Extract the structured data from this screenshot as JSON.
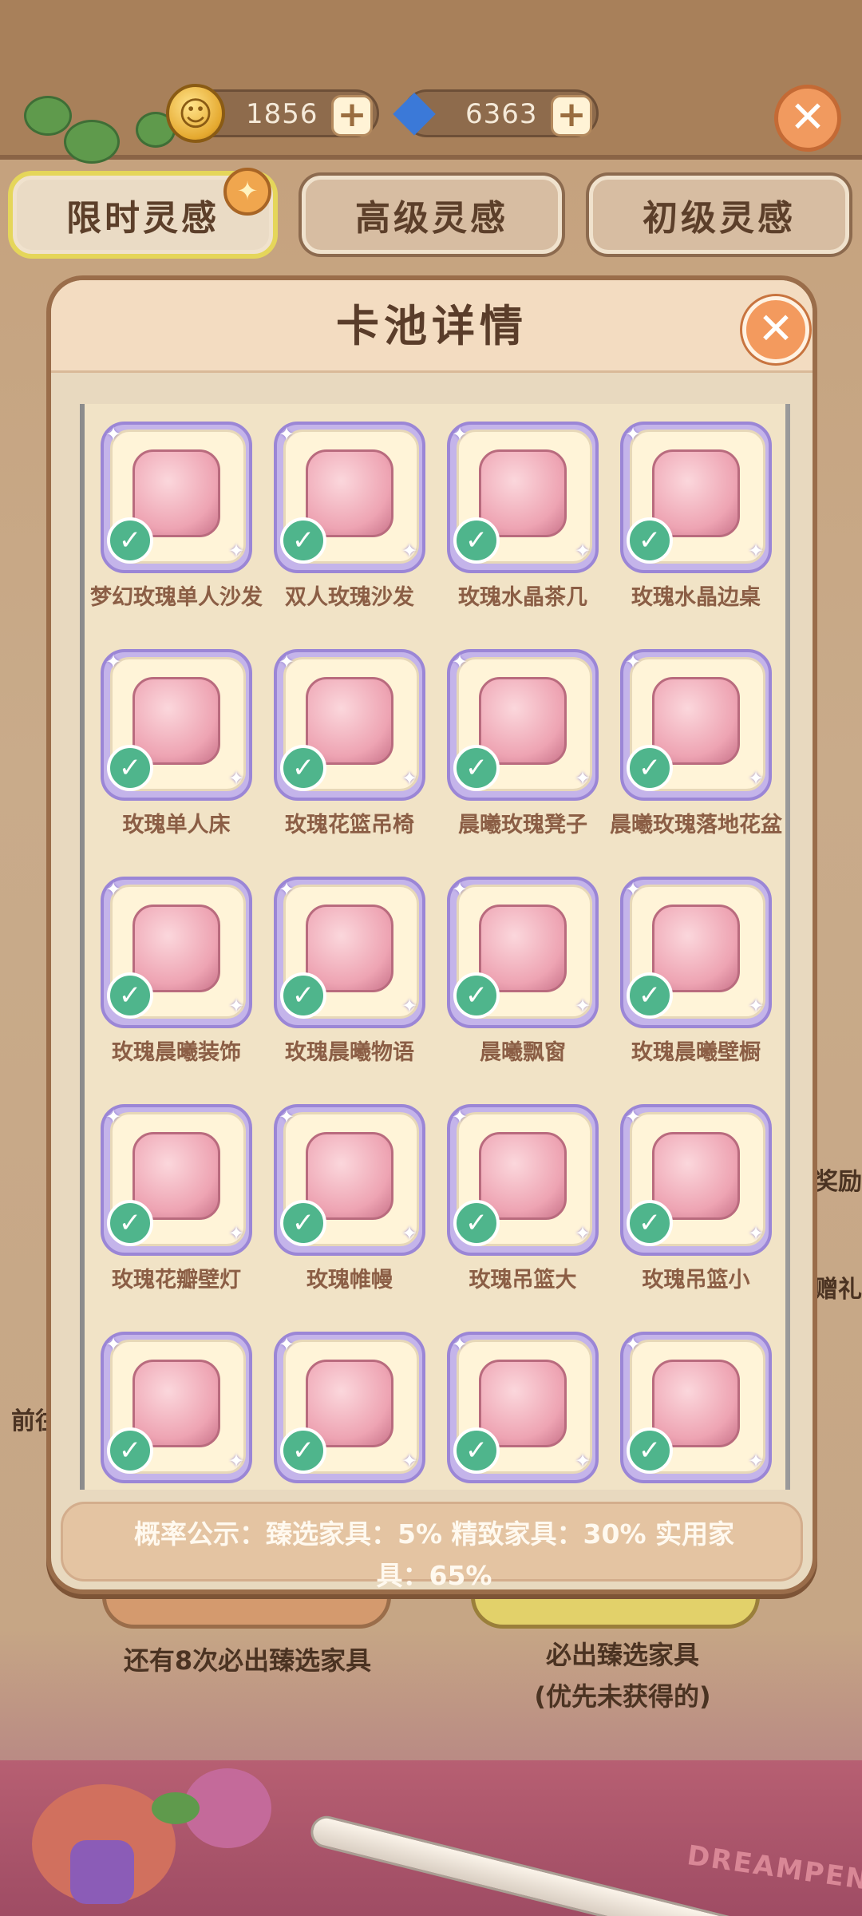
{
  "currency": {
    "coins": "1856",
    "gems": "6363"
  },
  "tabs": [
    {
      "label": "限时灵感",
      "active": true
    },
    {
      "label": "高级灵感",
      "active": false
    },
    {
      "label": "初级灵感",
      "active": false
    }
  ],
  "background": {
    "guarantee_left": "还有8次必出臻选家具",
    "guarantee_right_line1": "必出臻选家具",
    "guarantee_right_line2": "(优先未获得的)",
    "side_reward": "奖励",
    "side_gift": "赠礼",
    "side_prev": "前往",
    "watermark": "DREAMPEN"
  },
  "modal": {
    "title": "卡池详情",
    "items": [
      {
        "label": "梦幻玫瑰单人沙发",
        "owned": true
      },
      {
        "label": "双人玫瑰沙发",
        "owned": true
      },
      {
        "label": "玫瑰水晶茶几",
        "owned": true
      },
      {
        "label": "玫瑰水晶边桌",
        "owned": true
      },
      {
        "label": "玫瑰单人床",
        "owned": true
      },
      {
        "label": "玫瑰花篮吊椅",
        "owned": true
      },
      {
        "label": "晨曦玫瑰凳子",
        "owned": true
      },
      {
        "label": "晨曦玫瑰落地花盆",
        "owned": true
      },
      {
        "label": "玫瑰晨曦装饰",
        "owned": true
      },
      {
        "label": "玫瑰晨曦物语",
        "owned": true
      },
      {
        "label": "晨曦飘窗",
        "owned": true
      },
      {
        "label": "玫瑰晨曦壁橱",
        "owned": true
      },
      {
        "label": "玫瑰花瓣壁灯",
        "owned": true
      },
      {
        "label": "玫瑰帷幔",
        "owned": true
      },
      {
        "label": "玫瑰吊篮大",
        "owned": true
      },
      {
        "label": "玫瑰吊篮小",
        "owned": true
      },
      {
        "label": "",
        "owned": true
      },
      {
        "label": "",
        "owned": true
      },
      {
        "label": "",
        "owned": true
      },
      {
        "label": "",
        "owned": true
      }
    ],
    "probability_line1": "概率公示：臻选家具：5%   精致家具：30%   实用家",
    "probability_line2": "具：65%"
  },
  "colors": {
    "accent_close": "#f39a5e",
    "check": "#4fb58c",
    "card_frame": "#c4b4ea"
  }
}
